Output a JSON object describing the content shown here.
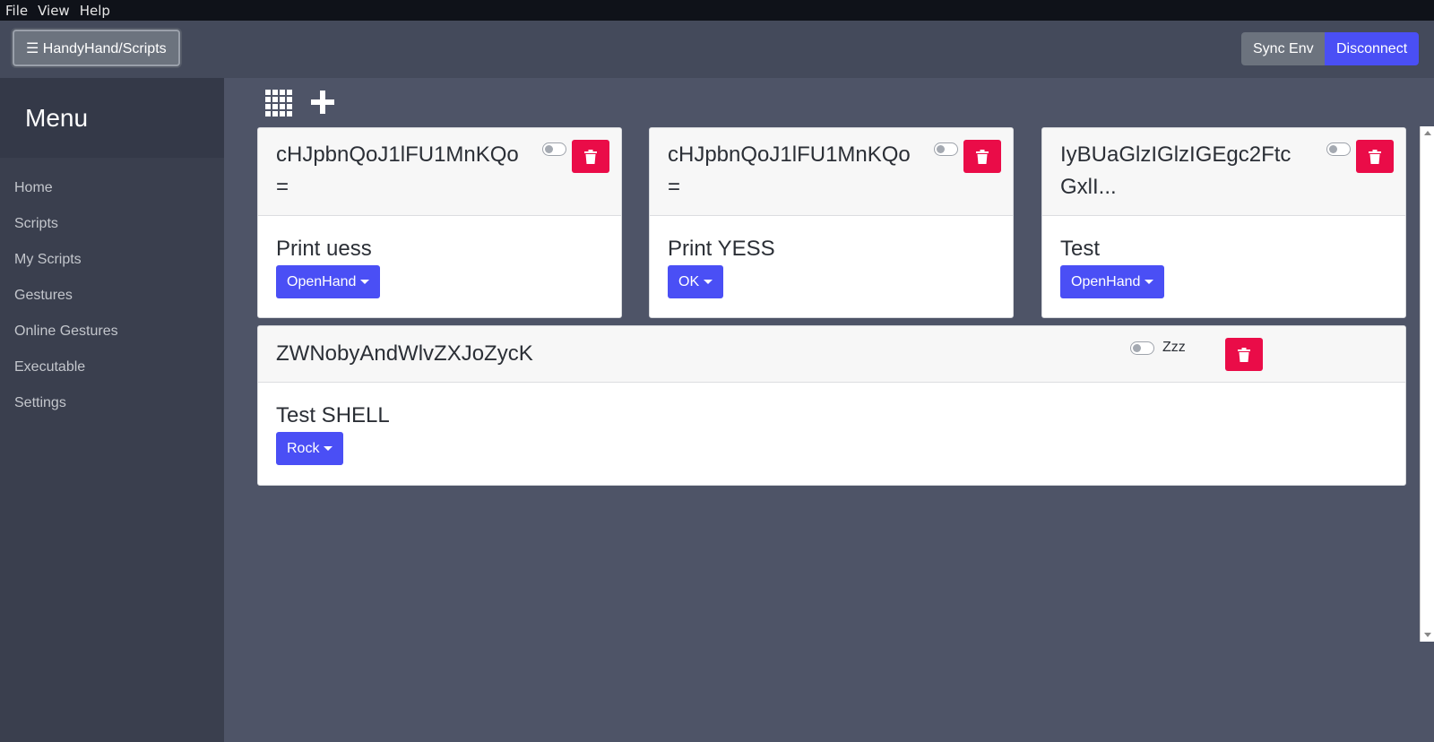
{
  "menubar": {
    "file": "File",
    "view": "View",
    "help": "Help"
  },
  "header": {
    "brand": "☰ HandyHand/Scripts",
    "sync": "Sync Env",
    "disconnect": "Disconnect"
  },
  "sidebar": {
    "title": "Menu",
    "items": [
      {
        "label": "Home"
      },
      {
        "label": "Scripts"
      },
      {
        "label": "My Scripts"
      },
      {
        "label": "Gestures"
      },
      {
        "label": "Online Gestures"
      },
      {
        "label": "Executable"
      },
      {
        "label": "Settings"
      }
    ]
  },
  "toolbar": {
    "grid_icon": "grid-icon",
    "add_icon": "plus-icon"
  },
  "cards": [
    {
      "title": "cHJpbnQoJ1lFU1MnKQo=",
      "name": "Print uess",
      "gesture": "OpenHand",
      "enabled": false
    },
    {
      "title": "cHJpbnQoJ1lFU1MnKQo=",
      "name": "Print YESS",
      "gesture": "OK",
      "enabled": false
    },
    {
      "title": "IyBUaGlzIGlzIGEgc2FtcGxlI...",
      "name": "Test",
      "gesture": "OpenHand",
      "enabled": false
    },
    {
      "title": "ZWNobyAndWlvZXJoZycK",
      "name": "Test SHELL",
      "gesture": "Rock",
      "enabled": false,
      "toggle_label": "Zzz"
    }
  ],
  "colors": {
    "primary": "#4a4ff5",
    "danger": "#ea0c48",
    "secondary": "#6c737e",
    "background": "#4e5467",
    "sidebar": "#3a3f4e"
  }
}
